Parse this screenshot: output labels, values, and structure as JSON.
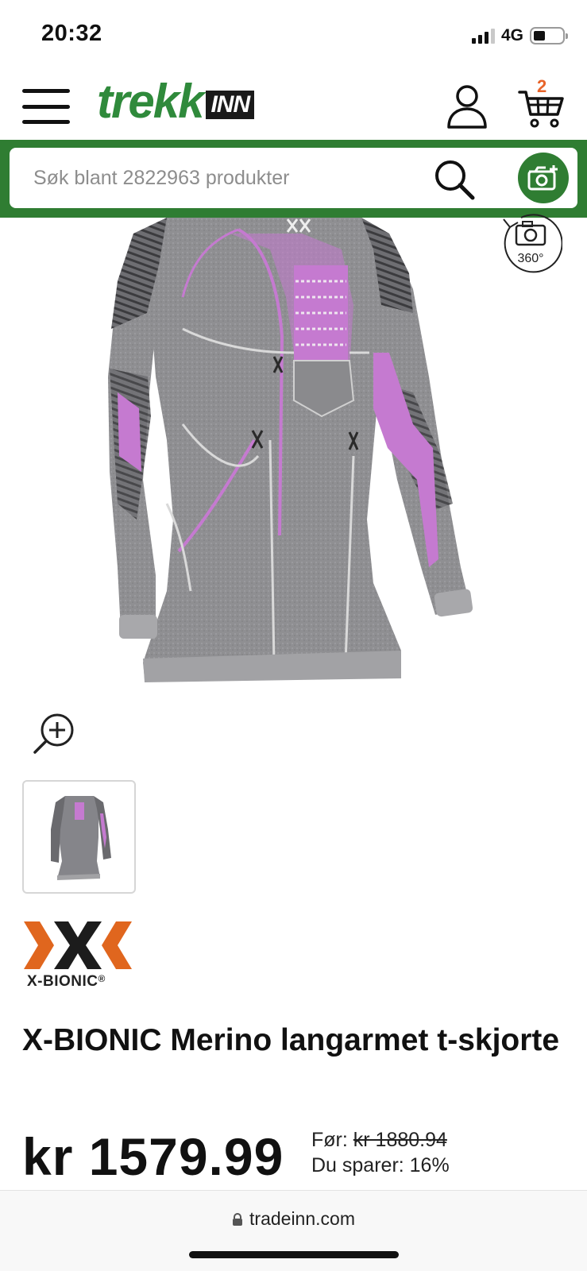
{
  "status_bar": {
    "time": "20:32",
    "network": "4G"
  },
  "header": {
    "logo_main": "trekk",
    "logo_sub": "INN",
    "cart_count": "2"
  },
  "search": {
    "placeholder": "Søk blant 2822963 produkter"
  },
  "gallery": {
    "view360_label": "360°"
  },
  "brand": {
    "name": "X-BIONIC",
    "registered": "®"
  },
  "product": {
    "title": "X-BIONIC Merino langarmet t-skjorte",
    "price": "kr 1579.99",
    "before_label": "Før:",
    "before_price": "kr 1880.94",
    "savings": "Du sparer: 16%"
  },
  "browser": {
    "url": "tradeinn.com"
  },
  "colors": {
    "brand_green": "#2f7d32",
    "cart_badge": "#e8642a",
    "garment_grey": "#8a8a8c",
    "garment_pink": "#c57ad0"
  }
}
